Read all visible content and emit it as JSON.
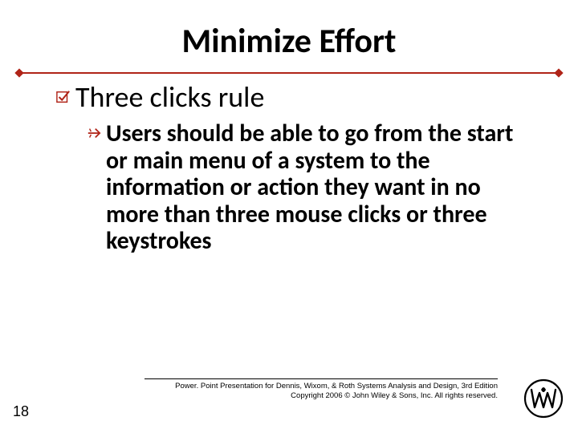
{
  "slide": {
    "title": "Minimize Effort",
    "level1": "Three clicks rule",
    "level2": "Users should be able to go from the start or main menu of a system to the information or action they want in no more than three mouse clicks or three keystrokes",
    "footer_line1": "Power. Point Presentation for Dennis, Wixom, & Roth Systems Analysis and Design, 3rd Edition",
    "footer_line2": "Copyright 2006 © John Wiley & Sons, Inc.  All rights reserved.",
    "page_number": "18",
    "publisher_logo": "Wiley"
  },
  "colors": {
    "accent": "#b02418"
  }
}
